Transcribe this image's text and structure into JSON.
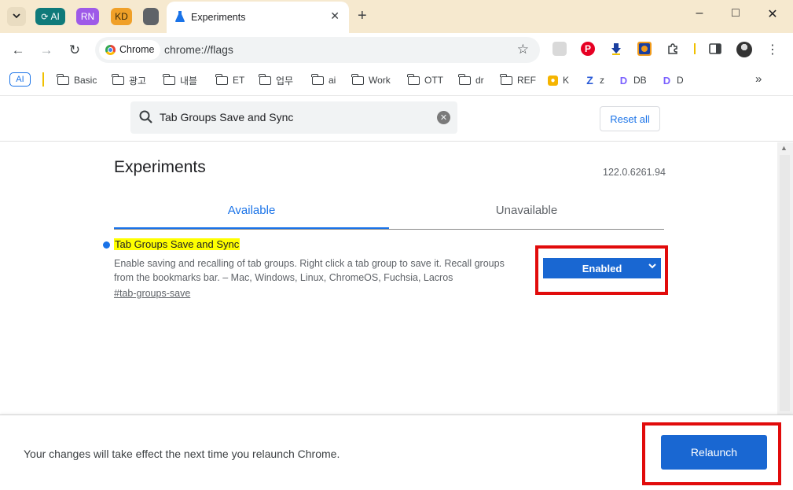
{
  "colors": {
    "tabstrip_bg": "#f6e9cf",
    "accent_blue": "#1a73e8",
    "button_blue": "#1967d2",
    "highlight_yellow": "#ffff00",
    "annotation_red": "#e10b0b"
  },
  "tabstrip": {
    "tab_search_icon": "chevron-down-icon",
    "groups": [
      {
        "label": "AI",
        "color": "#0f7a7a",
        "icon": "sync-icon"
      },
      {
        "label": "RN",
        "color": "#9e5ae8"
      },
      {
        "label": "KD",
        "color": "#f0a028"
      },
      {
        "label": "",
        "color": "#5f6368"
      }
    ],
    "active_tab": {
      "title": "Experiments",
      "icon": "flask-icon",
      "close_glyph": "✕"
    },
    "new_tab_glyph": "+",
    "window_controls": {
      "minimize": "–",
      "maximize": "□",
      "close": "✕"
    }
  },
  "toolbar": {
    "back_glyph": "←",
    "forward_glyph": "→",
    "reload_glyph": "↻",
    "site_chip": "Chrome",
    "url": "chrome://flags",
    "star_glyph": "☆",
    "extensions": [
      "gray-extension-icon",
      "pinterest-icon",
      "download-arrow-icon",
      "colorful-extension-icon",
      "puzzle-icon"
    ],
    "side_panel_icon": "side-panel-icon",
    "menu_glyph": "⋮"
  },
  "bookmarks": {
    "ai_chip": "AI",
    "items": [
      {
        "label": "Basic",
        "type": "folder"
      },
      {
        "label": "광고",
        "type": "folder"
      },
      {
        "label": "내블",
        "type": "folder"
      },
      {
        "label": "ET",
        "type": "folder"
      },
      {
        "label": "업무",
        "type": "folder"
      },
      {
        "label": "ai",
        "type": "folder"
      },
      {
        "label": "Work",
        "type": "folder"
      },
      {
        "label": "OTT",
        "type": "folder"
      },
      {
        "label": "dr",
        "type": "folder"
      },
      {
        "label": "REF",
        "type": "folder"
      },
      {
        "label": "K",
        "type": "site",
        "color": "#f5b400"
      },
      {
        "label": "z",
        "type": "site",
        "color": "#2a5bd7"
      },
      {
        "label": "DB",
        "type": "site",
        "color": "#7b61ff"
      },
      {
        "label": "D",
        "type": "site",
        "color": "#7b61ff"
      }
    ],
    "more_glyph": "»"
  },
  "flags_page": {
    "search": {
      "query": "Tab Groups Save and Sync",
      "clear_glyph": "✕"
    },
    "reset_all": "Reset all",
    "title": "Experiments",
    "version": "122.0.6261.94",
    "tabs": {
      "available": "Available",
      "unavailable": "Unavailable"
    },
    "flag": {
      "name": "Tab Groups Save and Sync",
      "description": "Enable saving and recalling of tab groups. Right click a tab group to save it. Recall groups from the bookmarks bar. – Mac, Windows, Linux, ChromeOS, Fuchsia, Lacros",
      "link": "#tab-groups-save",
      "select_value": "Enabled"
    },
    "footer": {
      "message": "Your changes will take effect the next time you relaunch Chrome.",
      "relaunch": "Relaunch"
    }
  }
}
